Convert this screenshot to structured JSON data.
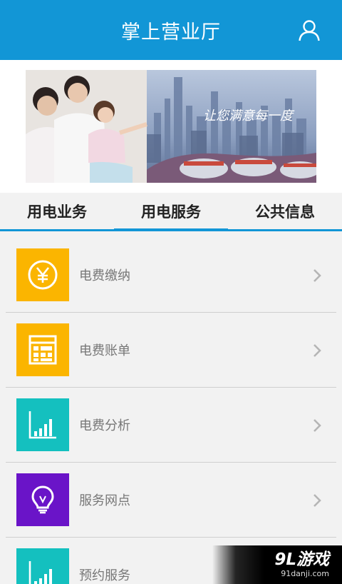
{
  "header": {
    "title": "掌上营业厅",
    "user_icon": "user-icon",
    "color": "#1296d6"
  },
  "banner": {
    "slogan": "让您满意每一度"
  },
  "tabs": [
    {
      "label": "用电业务",
      "active": false
    },
    {
      "label": "用电服务",
      "active": true
    },
    {
      "label": "公共信息",
      "active": false
    }
  ],
  "menu": [
    {
      "label": "电费缴纳",
      "icon": "yen-icon",
      "color": "#fbb500"
    },
    {
      "label": "电费账单",
      "icon": "bill-icon",
      "color": "#fbb500"
    },
    {
      "label": "电费分析",
      "icon": "bar-chart-icon",
      "color": "#14c0bf"
    },
    {
      "label": "服务网点",
      "icon": "lightbulb-icon",
      "color": "#6a14c8"
    },
    {
      "label": "预约服务",
      "icon": "bar-chart-icon",
      "color": "#14c0bf"
    }
  ],
  "watermark": {
    "logo": "9L游戏",
    "url": "91danji.com"
  }
}
